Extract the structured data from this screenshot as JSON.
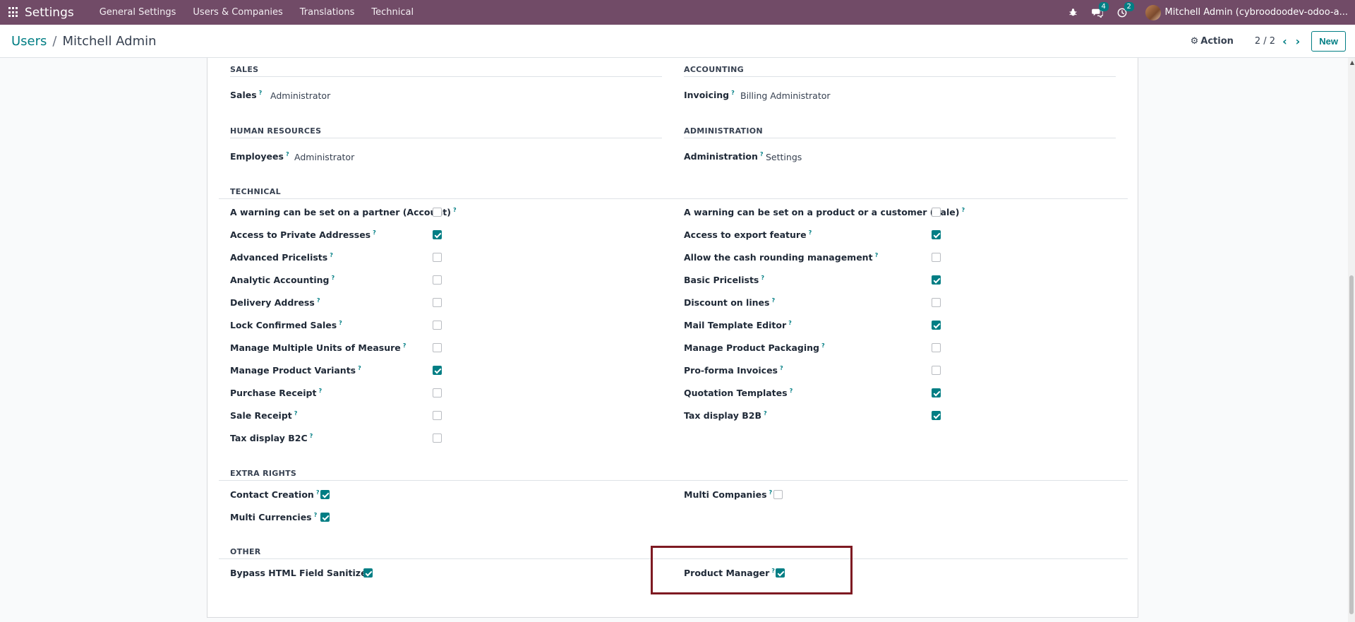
{
  "navbar": {
    "brand": "Settings",
    "menu": [
      "General Settings",
      "Users & Companies",
      "Translations",
      "Technical"
    ],
    "messages_count": "4",
    "activities_count": "2",
    "user": "Mitchell Admin (cybroodoodev-odoo-a..."
  },
  "control_panel": {
    "breadcrumb_parent": "Users",
    "breadcrumb_current": "Mitchell Admin",
    "action_label": "Action",
    "pager": "2 / 2",
    "new_label": "New"
  },
  "sections": {
    "sales": {
      "title": "SALES",
      "label": "Sales",
      "value": "Administrator"
    },
    "accounting": {
      "title": "ACCOUNTING",
      "label": "Invoicing",
      "value": "Billing Administrator"
    },
    "hr": {
      "title": "HUMAN RESOURCES",
      "label": "Employees",
      "value": "Administrator"
    },
    "administration": {
      "title": "ADMINISTRATION",
      "label": "Administration",
      "value": "Settings"
    },
    "technical": {
      "title": "TECHNICAL",
      "left": [
        {
          "label": "A warning can be set on a partner (Account)",
          "checked": false
        },
        {
          "label": "Access to Private Addresses",
          "checked": true
        },
        {
          "label": "Advanced Pricelists",
          "checked": false
        },
        {
          "label": "Analytic Accounting",
          "checked": false
        },
        {
          "label": "Delivery Address",
          "checked": false
        },
        {
          "label": "Lock Confirmed Sales",
          "checked": false
        },
        {
          "label": "Manage Multiple Units of Measure",
          "checked": false
        },
        {
          "label": "Manage Product Variants",
          "checked": true
        },
        {
          "label": "Purchase Receipt",
          "checked": false
        },
        {
          "label": "Sale Receipt",
          "checked": false
        },
        {
          "label": "Tax display B2C",
          "checked": false
        }
      ],
      "right": [
        {
          "label": "A warning can be set on a product or a customer (Sale)",
          "checked": false
        },
        {
          "label": "Access to export feature",
          "checked": true
        },
        {
          "label": "Allow the cash rounding management",
          "checked": false
        },
        {
          "label": "Basic Pricelists",
          "checked": true
        },
        {
          "label": "Discount on lines",
          "checked": false
        },
        {
          "label": "Mail Template Editor",
          "checked": true
        },
        {
          "label": "Manage Product Packaging",
          "checked": false
        },
        {
          "label": "Pro-forma Invoices",
          "checked": false
        },
        {
          "label": "Quotation Templates",
          "checked": true
        },
        {
          "label": "Tax display B2B",
          "checked": true
        }
      ]
    },
    "extra_rights": {
      "title": "EXTRA RIGHTS",
      "left": [
        {
          "label": "Contact Creation",
          "checked": true
        },
        {
          "label": "Multi Currencies",
          "checked": true
        }
      ],
      "right": [
        {
          "label": "Multi Companies",
          "checked": false
        }
      ]
    },
    "other": {
      "title": "OTHER",
      "left": [
        {
          "label": "Bypass HTML Field Sanitize",
          "checked": true
        }
      ],
      "right": [
        {
          "label": "Product Manager",
          "checked": true
        }
      ]
    }
  },
  "help_marker": "?"
}
